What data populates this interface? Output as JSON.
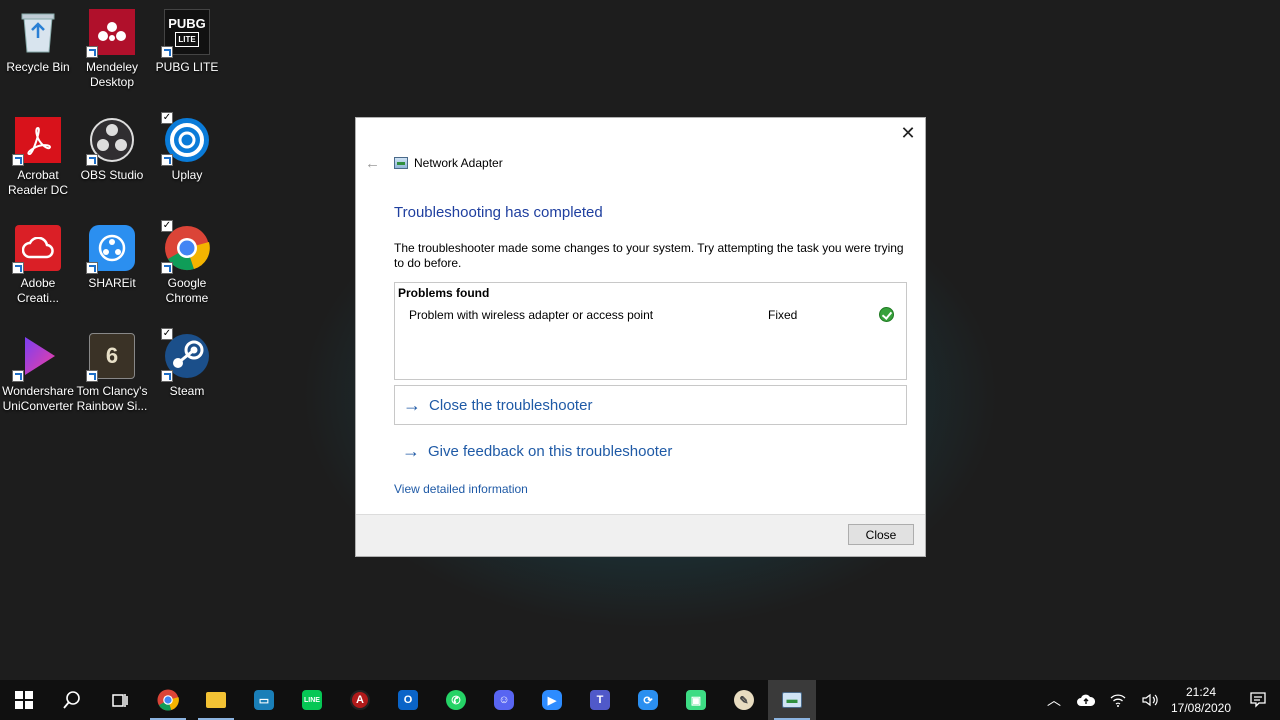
{
  "desktop": {
    "icons": [
      {
        "label": "Recycle Bin"
      },
      {
        "label": "Mendeley Desktop"
      },
      {
        "label": "PUBG LITE"
      },
      {
        "label": "Acrobat Reader DC"
      },
      {
        "label": "OBS Studio"
      },
      {
        "label": "Uplay"
      },
      {
        "label": "Adobe Creati..."
      },
      {
        "label": "SHAREit"
      },
      {
        "label": "Google Chrome"
      },
      {
        "label": "Wondershare UniConverter"
      },
      {
        "label": "Tom Clancy's Rainbow Si..."
      },
      {
        "label": "Steam"
      }
    ]
  },
  "dialog": {
    "close_glyph": "✕",
    "back_glyph": "←",
    "nav_title": "Network Adapter",
    "heading": "Troubleshooting has completed",
    "description": "The troubleshooter made some changes to your system. Try attempting the task you were trying to do before.",
    "problems": {
      "header": "Problems found",
      "items": [
        {
          "name": "Problem with wireless adapter or access point",
          "status": "Fixed"
        }
      ]
    },
    "actions": {
      "close_troubleshooter": "Close the troubleshooter",
      "give_feedback": "Give feedback on this troubleshooter"
    },
    "detail_link": "View detailed information",
    "footer_close": "Close"
  },
  "taskbar": {
    "clock_time": "21:24",
    "clock_date": "17/08/2020"
  }
}
